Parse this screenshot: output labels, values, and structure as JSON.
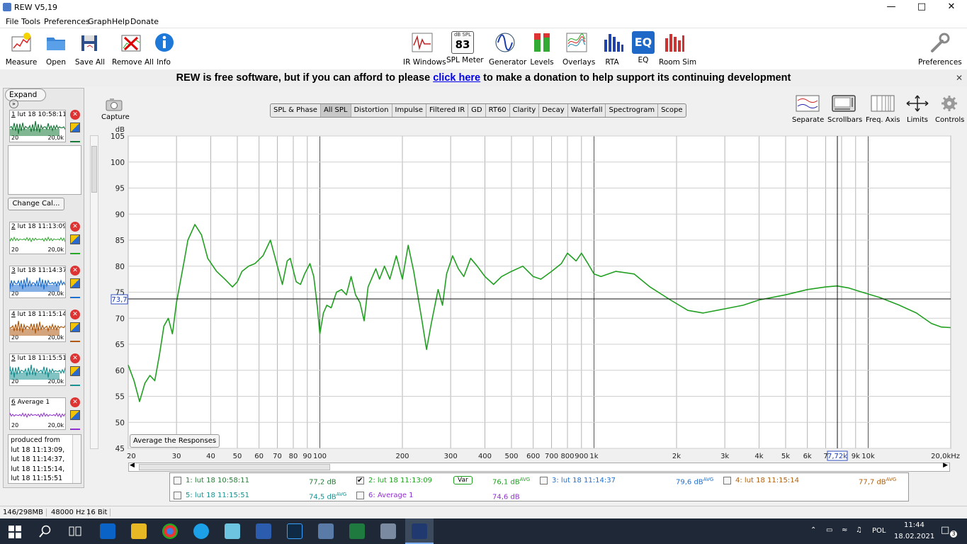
{
  "window": {
    "title": "REW V5,19"
  },
  "menu": [
    "File",
    "Tools",
    "Preferences",
    "Graph",
    "Help",
    "Donate"
  ],
  "toolbar_left": [
    "Measure",
    "Open",
    "Save All",
    "Remove All",
    "Info"
  ],
  "toolbar_center": [
    "IR Windows",
    "SPL Meter",
    "Generator",
    "Levels",
    "Overlays",
    "RTA",
    "EQ",
    "Room Sim"
  ],
  "spl_meter": {
    "unit": "dB SPL",
    "value": "83"
  },
  "eq_icon_text": "EQ",
  "toolbar_right": "Preferences",
  "banner": {
    "pre": "REW is free software, but if you can afford to please",
    "link": "click here",
    "post": "to make a donation to help support its continuing development"
  },
  "left_panel": {
    "expand": "Expand",
    "change_cal": "Change Cal...",
    "measurements": [
      {
        "num": "1",
        "label": "lut 18 10:58:11",
        "lo": "20",
        "hi": "20,0k",
        "color": "#1a7a3a"
      },
      {
        "num": "2",
        "label": "lut 18 11:13:09",
        "lo": "20",
        "hi": "20,0k",
        "color": "#28a828"
      },
      {
        "num": "3",
        "label": "lut 18 11:14:37",
        "lo": "20",
        "hi": "20,0k",
        "color": "#1f6fd0"
      },
      {
        "num": "4",
        "label": "lut 18 11:15:14",
        "lo": "20",
        "hi": "20,0k",
        "color": "#b05a10"
      },
      {
        "num": "5",
        "label": "lut 18 11:15:51",
        "lo": "20",
        "hi": "20,0k",
        "color": "#1a9090"
      },
      {
        "num": "6",
        "label": "Average 1",
        "lo": "20",
        "hi": "20,0k",
        "color": "#9030d0"
      }
    ],
    "notes": "produced from lut 18 11:13:09, lut 18 11:14:37, lut 18 11:15:14, lut 18 11:15:51"
  },
  "capture": "Capture",
  "tabs": [
    "SPL & Phase",
    "All SPL",
    "Distortion",
    "Impulse",
    "Filtered IR",
    "GD",
    "RT60",
    "Clarity",
    "Decay",
    "Waterfall",
    "Spectrogram",
    "Scope"
  ],
  "selected_tab": "All SPL",
  "right_controls": [
    "Separate",
    "Scrollbars",
    "Freq. Axis",
    "Limits",
    "Controls"
  ],
  "average_button": "Average the Responses",
  "legend": [
    {
      "id": "1",
      "name": "1: lut 18 10:58:11",
      "value": "77,2 dB",
      "sup": "",
      "checked": false,
      "color": "#2a7a3a"
    },
    {
      "id": "2",
      "name": "2: lut 18 11:13:09",
      "value": "76,1 dB",
      "sup": "AVG",
      "checked": true,
      "color": "#20a020",
      "badge": "Var"
    },
    {
      "id": "3",
      "name": "3: lut 18 11:14:37",
      "value": "79,6 dB",
      "sup": "AVG",
      "checked": false,
      "color": "#2070d0"
    },
    {
      "id": "4",
      "name": "4: lut 18 11:15:14",
      "value": "77,7 dB",
      "sup": "AVG",
      "checked": false,
      "color": "#b06010"
    },
    {
      "id": "5",
      "name": "5: lut 18 11:15:51",
      "value": "74,5 dB",
      "sup": "AVG",
      "checked": false,
      "color": "#1a9090"
    },
    {
      "id": "6",
      "name": "6: Average 1",
      "value": "74,6 dB",
      "sup": "",
      "checked": false,
      "color": "#9030d0"
    }
  ],
  "status": {
    "memory": "146/298MB",
    "rate": "48000 Hz",
    "bits": "16 Bit"
  },
  "taskbar": {
    "lang": "POL",
    "time": "11:44",
    "date": "18.02.2021",
    "notif": "3"
  },
  "chart_data": {
    "type": "line",
    "ylabel": "dB",
    "xunit": "Hz",
    "xscale": "log",
    "xlim": [
      20,
      20000
    ],
    "ylim": [
      45,
      105
    ],
    "yticks": [
      "45",
      "50",
      "55",
      "60",
      "65",
      "70",
      "75",
      "80",
      "85",
      "90",
      "95",
      "100",
      "105"
    ],
    "xticks": [
      {
        "v": 20,
        "t": "20"
      },
      {
        "v": 30,
        "t": "30"
      },
      {
        "v": 40,
        "t": "40"
      },
      {
        "v": 50,
        "t": "50"
      },
      {
        "v": 60,
        "t": "60"
      },
      {
        "v": 70,
        "t": "70"
      },
      {
        "v": 80,
        "t": "80"
      },
      {
        "v": 90,
        "t": "90"
      },
      {
        "v": 100,
        "t": "100"
      },
      {
        "v": 200,
        "t": "200"
      },
      {
        "v": 300,
        "t": "300"
      },
      {
        "v": 400,
        "t": "400"
      },
      {
        "v": 500,
        "t": "500"
      },
      {
        "v": 600,
        "t": "600"
      },
      {
        "v": 700,
        "t": "700"
      },
      {
        "v": 800,
        "t": "800"
      },
      {
        "v": 900,
        "t": "900"
      },
      {
        "v": 1000,
        "t": "1k"
      },
      {
        "v": 2000,
        "t": "2k"
      },
      {
        "v": 3000,
        "t": "3k"
      },
      {
        "v": 4000,
        "t": "4k"
      },
      {
        "v": 5000,
        "t": "5k"
      },
      {
        "v": 6000,
        "t": "6k"
      },
      {
        "v": 7000,
        "t": "7"
      },
      {
        "v": 9000,
        "t": "9k"
      },
      {
        "v": 10000,
        "t": "10k"
      },
      {
        "v": 20000,
        "t": "20,0kHz"
      }
    ],
    "cursor": {
      "x": 7720,
      "y": 73.7,
      "xlabel": "7,72k",
      "ylabel": "73,7"
    },
    "series": [
      {
        "color": "#22a022",
        "points": [
          [
            20,
            61
          ],
          [
            21,
            58
          ],
          [
            22,
            54
          ],
          [
            23,
            57.5
          ],
          [
            24,
            59
          ],
          [
            25,
            58
          ],
          [
            26,
            63
          ],
          [
            27,
            68.5
          ],
          [
            28,
            70
          ],
          [
            29,
            67
          ],
          [
            30,
            73
          ],
          [
            32,
            81
          ],
          [
            33,
            85
          ],
          [
            35,
            88
          ],
          [
            37,
            86
          ],
          [
            39,
            81.5
          ],
          [
            42,
            79
          ],
          [
            45,
            77.5
          ],
          [
            48,
            76
          ],
          [
            50,
            77
          ],
          [
            52,
            79
          ],
          [
            55,
            80
          ],
          [
            58,
            80.5
          ],
          [
            62,
            82
          ],
          [
            66,
            85
          ],
          [
            70,
            80
          ],
          [
            73,
            76.5
          ],
          [
            76,
            81
          ],
          [
            78,
            81.5
          ],
          [
            82,
            77
          ],
          [
            85,
            76.5
          ],
          [
            88,
            78.5
          ],
          [
            92,
            80.5
          ],
          [
            95,
            78
          ],
          [
            98,
            72
          ],
          [
            100,
            67
          ],
          [
            103,
            71
          ],
          [
            106,
            72.5
          ],
          [
            110,
            72
          ],
          [
            115,
            75
          ],
          [
            120,
            75.5
          ],
          [
            125,
            74.5
          ],
          [
            130,
            78
          ],
          [
            135,
            74.5
          ],
          [
            140,
            73
          ],
          [
            145,
            69.5
          ],
          [
            150,
            76
          ],
          [
            160,
            79.5
          ],
          [
            165,
            77.5
          ],
          [
            172,
            80
          ],
          [
            180,
            77.5
          ],
          [
            190,
            82
          ],
          [
            200,
            77.5
          ],
          [
            210,
            84
          ],
          [
            220,
            79
          ],
          [
            235,
            70
          ],
          [
            245,
            64
          ],
          [
            255,
            69
          ],
          [
            270,
            75.5
          ],
          [
            280,
            72.5
          ],
          [
            290,
            78.5
          ],
          [
            305,
            82
          ],
          [
            320,
            79.5
          ],
          [
            335,
            78
          ],
          [
            355,
            81.5
          ],
          [
            375,
            80
          ],
          [
            400,
            78
          ],
          [
            430,
            76.5
          ],
          [
            460,
            78
          ],
          [
            500,
            79
          ],
          [
            550,
            80
          ],
          [
            600,
            78
          ],
          [
            640,
            77.5
          ],
          [
            700,
            79
          ],
          [
            760,
            80.5
          ],
          [
            800,
            82.5
          ],
          [
            860,
            81
          ],
          [
            900,
            82.5
          ],
          [
            950,
            80.5
          ],
          [
            1000,
            78.5
          ],
          [
            1060,
            78
          ],
          [
            1200,
            79
          ],
          [
            1400,
            78.5
          ],
          [
            1600,
            76
          ],
          [
            1900,
            73.5
          ],
          [
            2200,
            71.5
          ],
          [
            2500,
            71
          ],
          [
            3000,
            71.8
          ],
          [
            3500,
            72.5
          ],
          [
            4000,
            73.5
          ],
          [
            5000,
            74.5
          ],
          [
            6000,
            75.5
          ],
          [
            7000,
            76
          ],
          [
            7700,
            76.2
          ],
          [
            8500,
            75.8
          ],
          [
            9500,
            75
          ],
          [
            11000,
            74
          ],
          [
            13000,
            72.5
          ],
          [
            15000,
            71
          ],
          [
            17000,
            69
          ],
          [
            18500,
            68.3
          ],
          [
            20000,
            68.2
          ]
        ]
      }
    ]
  }
}
